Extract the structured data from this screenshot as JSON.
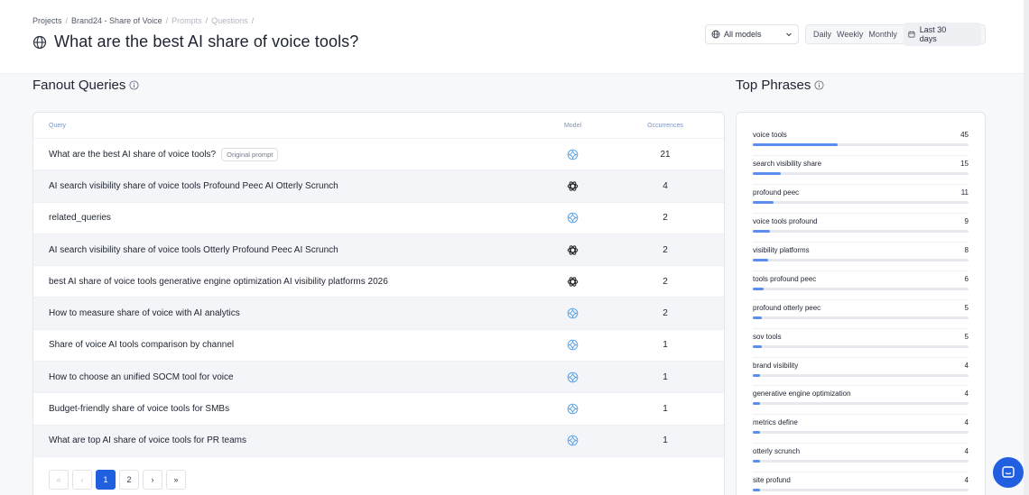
{
  "breadcrumb": [
    {
      "label": "Projects",
      "muted": false
    },
    {
      "label": "Brand24 - Share of Voice",
      "muted": false
    },
    {
      "label": "Prompts",
      "muted": true
    },
    {
      "label": "Questions",
      "muted": true
    }
  ],
  "page": {
    "title": "What are the best AI share of voice tools?",
    "title_icon": "globe-icon"
  },
  "filters": {
    "model_select": "All models",
    "period_tabs": [
      "Daily",
      "Weekly",
      "Monthly"
    ],
    "active_period": "Daily",
    "date_range": "Last 30 days"
  },
  "queries_section": {
    "title": "Fanout Queries",
    "columns": {
      "query": "Query",
      "model": "Model",
      "occurrences": "Occurrences"
    },
    "original_badge": "Original prompt",
    "rows": [
      {
        "query": "What are the best AI share of voice tools?",
        "model": "gemini",
        "occurrences": "21",
        "original": true
      },
      {
        "query": "AI search visibility share of voice tools Profound Peec AI Otterly Scrunch",
        "model": "openai",
        "occurrences": "4",
        "original": false
      },
      {
        "query": "related_queries",
        "model": "gemini",
        "occurrences": "2",
        "original": false
      },
      {
        "query": "AI search visibility share of voice tools Otterly Profound Peec AI Scrunch",
        "model": "openai",
        "occurrences": "2",
        "original": false
      },
      {
        "query": "best AI share of voice tools generative engine optimization AI visibility platforms 2026",
        "model": "openai",
        "occurrences": "2",
        "original": false
      },
      {
        "query": "How to measure share of voice with AI analytics",
        "model": "gemini",
        "occurrences": "2",
        "original": false
      },
      {
        "query": "Share of voice AI tools comparison by channel",
        "model": "gemini",
        "occurrences": "1",
        "original": false
      },
      {
        "query": "How to choose an unified SOCM tool for voice",
        "model": "gemini",
        "occurrences": "1",
        "original": false
      },
      {
        "query": "Budget-friendly share of voice tools for SMBs",
        "model": "gemini",
        "occurrences": "1",
        "original": false
      },
      {
        "query": "What are top AI share of voice tools for PR teams",
        "model": "gemini",
        "occurrences": "1",
        "original": false
      }
    ],
    "pagination": {
      "first": "«",
      "prev": "‹",
      "pages": [
        "1",
        "2"
      ],
      "current": "1",
      "next": "›",
      "last": "»"
    }
  },
  "phrases_section": {
    "title": "Top Phrases",
    "items": [
      {
        "phrase": "voice tools",
        "count": 45
      },
      {
        "phrase": "search visibility share",
        "count": 15
      },
      {
        "phrase": "profound peec",
        "count": 11
      },
      {
        "phrase": "voice tools profound",
        "count": 9
      },
      {
        "phrase": "visibility platforms",
        "count": 8
      },
      {
        "phrase": "tools profound peec",
        "count": 6
      },
      {
        "phrase": "profound otterly peec",
        "count": 5
      },
      {
        "phrase": "sov tools",
        "count": 5
      },
      {
        "phrase": "brand visibility",
        "count": 4
      },
      {
        "phrase": "generative engine optimization",
        "count": 4
      },
      {
        "phrase": "metrics define",
        "count": 4
      },
      {
        "phrase": "otterly scrunch",
        "count": 4
      },
      {
        "phrase": "site profund",
        "count": 4
      }
    ],
    "bar_max": 115
  },
  "colors": {
    "accent": "#1f5fe0",
    "bar_fill": "#5b8def",
    "gemini_icon": "#5aa3e8",
    "openai_icon": "#2b2b2b"
  }
}
